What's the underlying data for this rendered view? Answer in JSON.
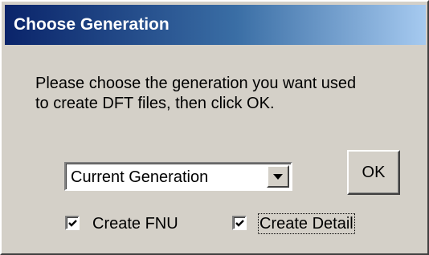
{
  "dialog": {
    "title": "Choose Generation",
    "message_lines": [
      "Please choose the generation you want used",
      "to create DFT files, then click OK."
    ]
  },
  "generation_select": {
    "value": "Current Generation"
  },
  "ok_button": {
    "label": "OK"
  },
  "checkboxes": [
    {
      "label": "Create FNU",
      "checked": true
    },
    {
      "label": "Create Detail",
      "checked": true,
      "focused": true
    }
  ],
  "colors": {
    "face": "#d4d0c8",
    "title_start": "#0a246a",
    "title_end": "#a6caf0"
  },
  "icons": {
    "dropdown": "chevron-down-icon",
    "check": "checkmark-icon"
  }
}
